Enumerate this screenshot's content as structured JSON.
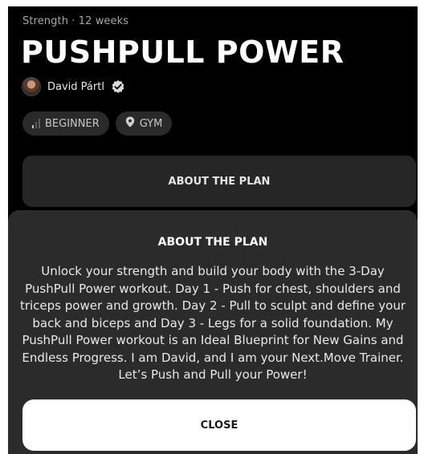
{
  "header": {
    "category": "Strength · 12 weeks",
    "title": "PUSHPULL POWER"
  },
  "author": {
    "name": "David Pártl",
    "avatar_icon": "avatar",
    "verified_icon": "verified-badge-icon"
  },
  "chips": [
    {
      "label": "BEGINNER",
      "icon": "difficulty-bars-icon",
      "level": 1,
      "level_max": 3
    },
    {
      "label": "GYM",
      "icon": "location-pin-icon"
    }
  ],
  "about_button": {
    "label": "ABOUT THE PLAN"
  },
  "sheet": {
    "title": "ABOUT THE PLAN",
    "body": "Unlock your strength and build your body with the 3-Day PushPull Power workout. Day 1 - Push for chest, shoulders and triceps power and growth. Day 2 - Pull to sculpt and define your back and biceps and Day 3 - Legs for a solid foundation. My PushPull Power workout is an Ideal Blueprint for New Gains and Endless Progress. I am David, and I am your Next.Move Trainer. Let’s Push and Pull your Power!",
    "close_label": "CLOSE"
  },
  "colors": {
    "background": "#000000",
    "chip": "#2a2a2a",
    "sheet": "#2b2b2b",
    "close_button": "#ffffff"
  }
}
